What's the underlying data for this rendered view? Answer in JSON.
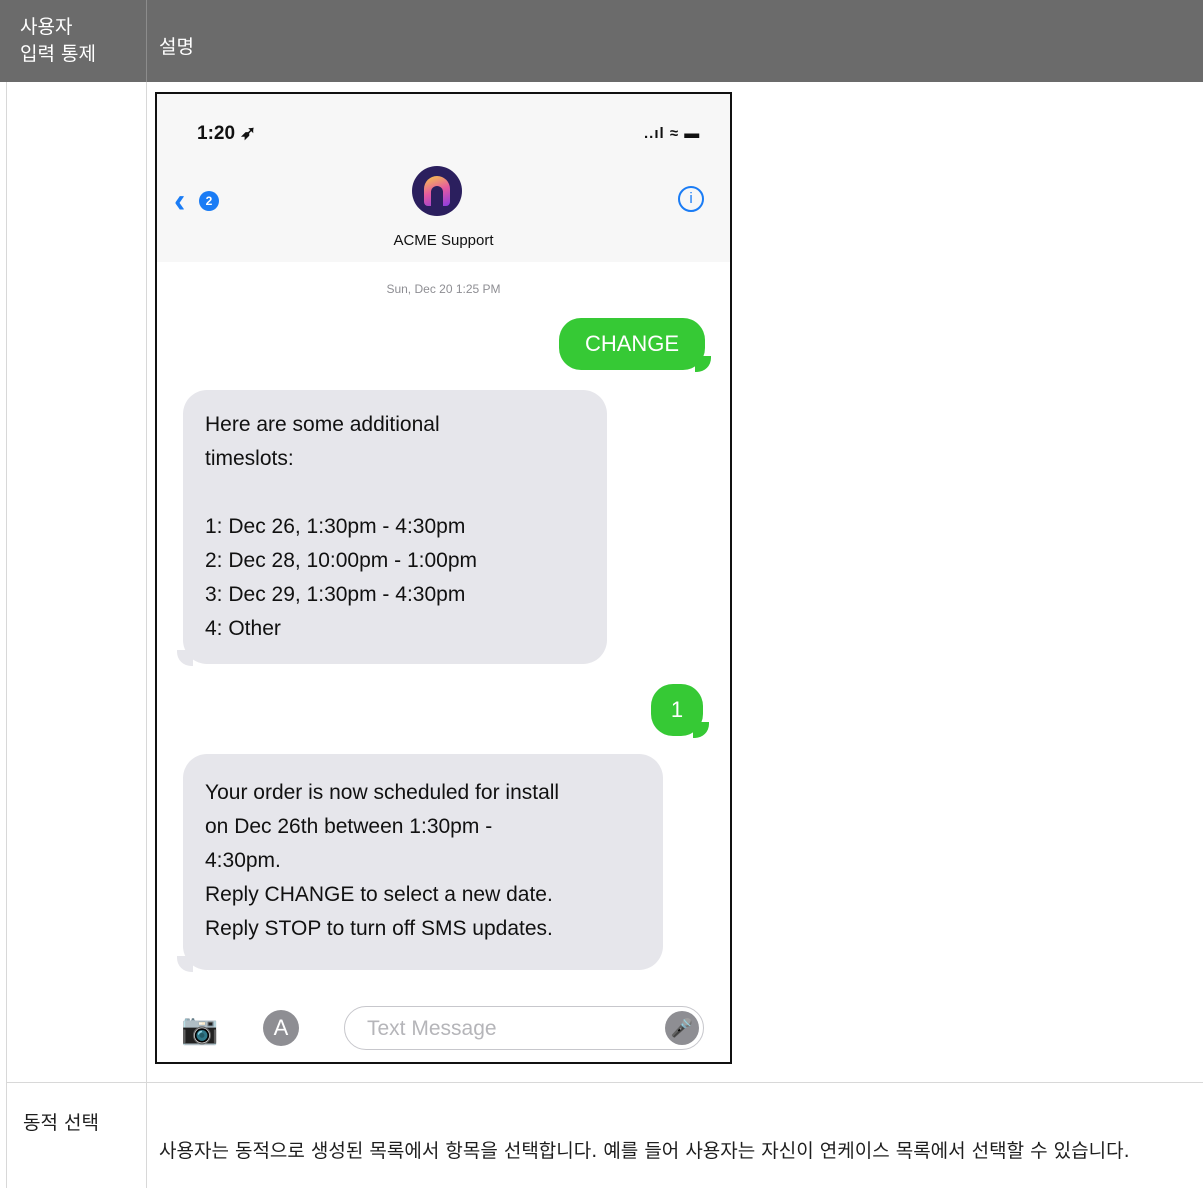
{
  "table": {
    "header_col1_line1": "사용자",
    "header_col1_line2": "입력 통제",
    "header_col2": "설명",
    "row2_label": "동적 선택",
    "row2_description": "사용자는 동적으로 생성된 목록에서 항목을 선택합니다. 예를 들어 사용자는 자신이 연케이스 목록에서 선택할 수 있습니다."
  },
  "phone": {
    "status_time": "1:20 ➶",
    "status_icons": "..ıl ≈ ▬",
    "back_badge": "2",
    "contact_name": "ACME Support",
    "timestamp": "Sun, Dec 20 1:25 PM",
    "messages": [
      {
        "dir": "out",
        "text": "CHANGE"
      },
      {
        "dir": "in",
        "text": "Here are some additional\ntimeslots:\n\n1: Dec 26, 1:30pm - 4:30pm\n2: Dec 28, 10:00pm - 1:00pm\n3: Dec 29, 1:30pm - 4:30pm\n4: Other"
      },
      {
        "dir": "out",
        "text": "1"
      },
      {
        "dir": "in",
        "text": "Your order is now scheduled for install\non Dec 26th between 1:30pm -\n4:30pm.\nReply CHANGE to select a new date.\nReply STOP to turn off SMS updates."
      }
    ],
    "input_placeholder": "Text Message"
  },
  "colors": {
    "header_bg": "#6b6b6b",
    "imessage_green": "#36c935",
    "ios_blue": "#1a7cf5"
  }
}
